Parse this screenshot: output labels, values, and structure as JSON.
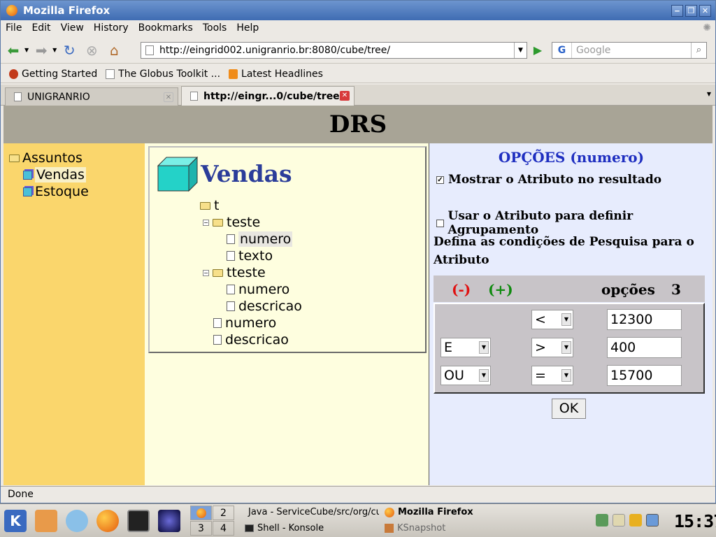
{
  "window": {
    "title": "Mozilla Firefox"
  },
  "menu": [
    "File",
    "Edit",
    "View",
    "History",
    "Bookmarks",
    "Tools",
    "Help"
  ],
  "nav": {
    "url": "http://eingrid002.unigranrio.br:8080/cube/tree/",
    "search_placeholder": "Google"
  },
  "bookmarks": [
    "Getting Started",
    "The Globus Toolkit ...",
    "Latest Headlines"
  ],
  "tabs": [
    {
      "label": "UNIGRANRIO",
      "active": false
    },
    {
      "label": "http://eingr...0/cube/tree/",
      "active": true
    }
  ],
  "page": {
    "header": "DRS",
    "sidebar": {
      "root": "Assuntos",
      "items": [
        "Vendas",
        "Estoque"
      ]
    },
    "tree": {
      "title": "Vendas",
      "root": "t",
      "nodes": [
        {
          "label": "teste",
          "children": [
            "numero",
            "texto"
          ]
        },
        {
          "label": "tteste",
          "children": [
            "numero",
            "descricao"
          ]
        }
      ],
      "leaves": [
        "numero",
        "descricao"
      ]
    },
    "options": {
      "title": "OPÇÕES (numero)",
      "show_attr": "Mostrar o Atributo no resultado",
      "show_attr_checked": true,
      "group_attr": "Usar o Atributo para definir Agrupamento",
      "group_attr_checked": false,
      "define": "Defina as condições de Pesquisa para o Atributo",
      "minus": "(-)",
      "plus": "(+)",
      "options_label": "opções",
      "options_count": "3",
      "conditions": [
        {
          "logic": "",
          "op": "<",
          "value": "12300"
        },
        {
          "logic": "E",
          "op": ">",
          "value": "400"
        },
        {
          "logic": "OU",
          "op": "=",
          "value": "15700"
        }
      ],
      "ok": "OK"
    }
  },
  "status": "Done",
  "taskbar": {
    "pager": [
      "1",
      "2",
      "3",
      "4"
    ],
    "tasks": [
      "Java - ServiceCube/src/org/cu",
      "Mozilla Firefox",
      "Shell - Konsole",
      "KSnapshot"
    ],
    "clock": "15:37"
  }
}
